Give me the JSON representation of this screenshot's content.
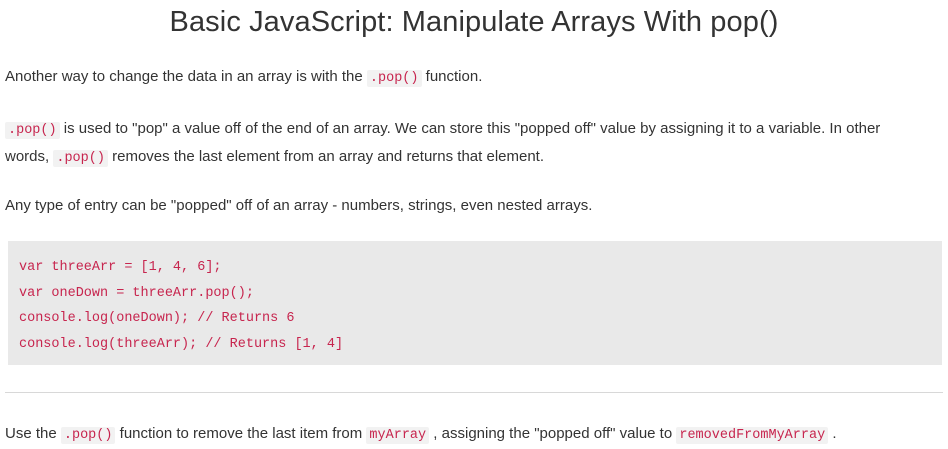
{
  "title": "Basic JavaScript: Manipulate Arrays With pop()",
  "para1": {
    "before": "Another way to change the data in an array is with the ",
    "code": ".pop()",
    "after": " function."
  },
  "para2": {
    "code1": ".pop()",
    "text1": " is used to \"pop\" a value off of the end of an array. We can store this \"popped off\" value by assigning it to a variable. In other words, ",
    "code2": ".pop()",
    "text2": " removes the last element from an array and returns that element."
  },
  "para3": {
    "text": "Any type of entry can be \"popped\" off of an array - numbers, strings, even nested arrays."
  },
  "code_block": {
    "lines": [
      "var threeArr = [1, 4, 6];",
      "var oneDown = threeArr.pop();",
      "console.log(oneDown); // Returns 6",
      "console.log(threeArr); // Returns [1, 4]"
    ]
  },
  "instruction": {
    "t1": "Use the ",
    "c1": ".pop()",
    "t2": " function to remove the last item from ",
    "c2": "myArray",
    "t3": " , assigning the \"popped off\" value to ",
    "c3": "removedFromMyArray",
    "t4": " ."
  }
}
